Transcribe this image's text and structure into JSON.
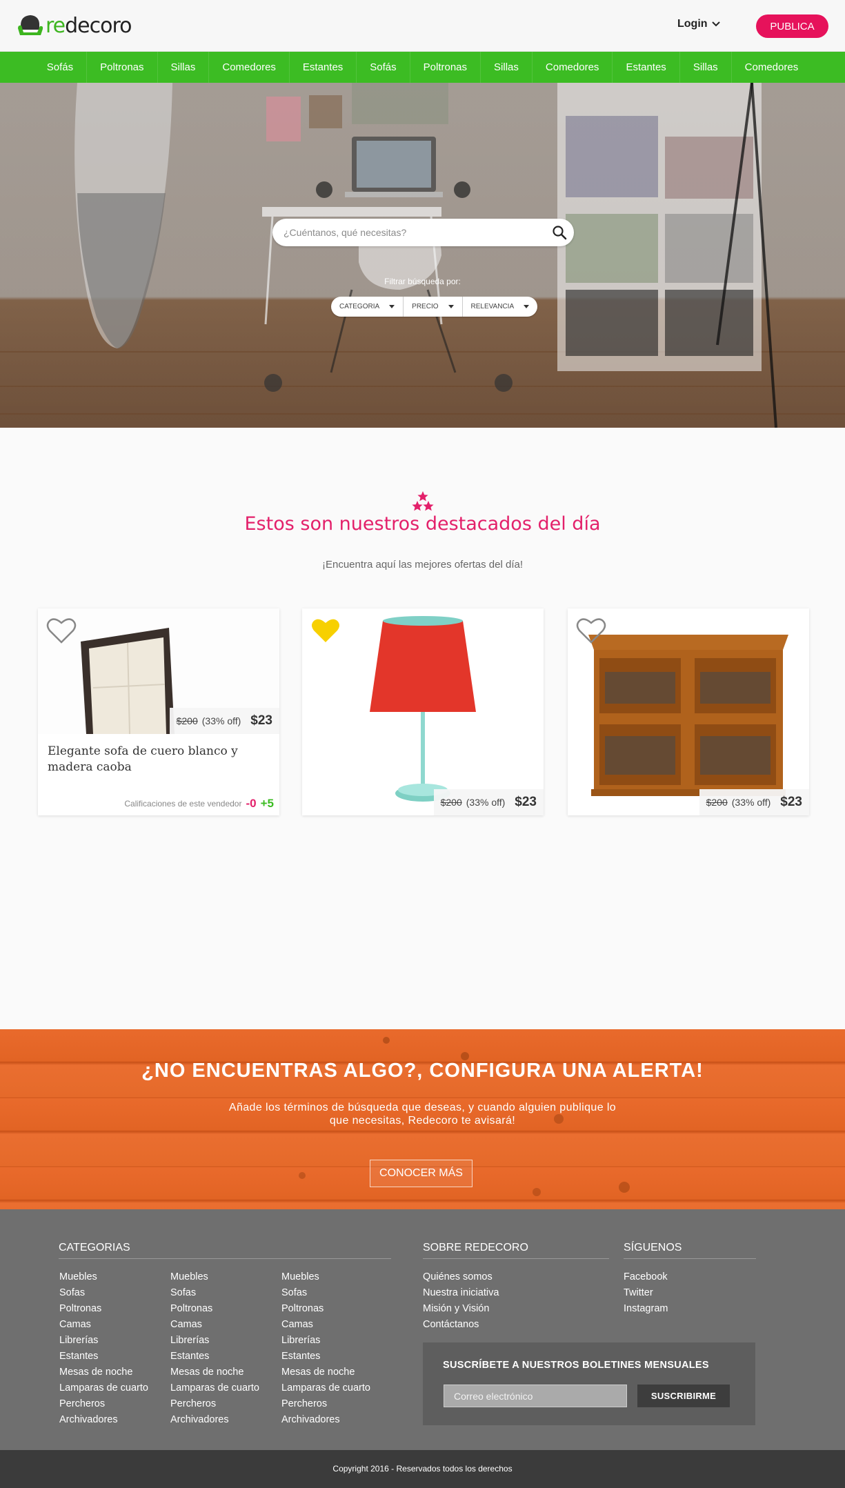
{
  "header": {
    "logo_prefix": "re",
    "logo_rest": "decoro",
    "login_label": "Login",
    "publish_label": "PUBLICA"
  },
  "nav": {
    "items": [
      "Sofás",
      "Poltronas",
      "Sillas",
      "Comedores",
      "Estantes",
      "Sofás",
      "Poltronas",
      "Sillas",
      "Comedores",
      "Estantes",
      "Sillas",
      "Comedores"
    ]
  },
  "hero": {
    "search_placeholder": "¿Cuéntanos, qué necesitas?",
    "filter_label": "Filtrar búsqueda por:",
    "filters": [
      "CATEGORIA",
      "PRECIO",
      "RELEVANCIA"
    ]
  },
  "featured": {
    "title": "Estos son nuestros destacados del día",
    "subtitle": "¡Encuentra aquí las mejores ofertas del día!",
    "cards": [
      {
        "favorited": false,
        "old_price": "$200",
        "discount": "(33% off)",
        "price": "$23",
        "title": "Elegante sofa de cuero blanco y madera caoba",
        "rating_label": "Calificaciones de este vendedor",
        "rating_negative": "-0",
        "rating_positive": "+5",
        "image_icon": "leather-chair-image"
      },
      {
        "favorited": true,
        "old_price": "$200",
        "discount": "(33% off)",
        "price": "$23",
        "image_icon": "red-lamp-image"
      },
      {
        "favorited": false,
        "old_price": "$200",
        "discount": "(33% off)",
        "price": "$23",
        "image_icon": "wooden-cabinet-image"
      }
    ]
  },
  "alert": {
    "title": "¿NO ENCUENTRAS ALGO?, CONFIGURA UNA ALERTA!",
    "subtitle": "Añade los términos de búsqueda que deseas, y cuando alguien publique lo que necesitas, Redecoro te avisará!",
    "button_label": "CONOCER MÁS"
  },
  "footer": {
    "categories_title": "CATEGORIAS",
    "categories_columns": [
      [
        "Muebles",
        "Sofas",
        "Poltronas",
        "Camas",
        "Librerías",
        "Estantes",
        "Mesas de noche",
        "Lamparas de cuarto",
        "Percheros",
        "Archivadores"
      ],
      [
        "Muebles",
        "Sofas",
        "Poltronas",
        "Camas",
        "Librerías",
        "Estantes",
        "Mesas de noche",
        "Lamparas de cuarto",
        "Percheros",
        "Archivadores"
      ],
      [
        "Muebles",
        "Sofas",
        "Poltronas",
        "Camas",
        "Librerías",
        "Estantes",
        "Mesas de noche",
        "Lamparas de cuarto",
        "Percheros",
        "Archivadores"
      ]
    ],
    "about_title": "SOBRE REDECORO",
    "about_links": [
      "Quiénes somos",
      "Nuestra iniciativa",
      "Misión y Visión",
      "Contáctanos"
    ],
    "follow_title": "SÍGUENOS",
    "follow_links": [
      "Facebook",
      "Twitter",
      "Instagram"
    ],
    "newsletter_title": "SUSCRÍBETE A NUESTROS BOLETINES MENSUALES",
    "newsletter_placeholder": "Correo electrónico",
    "newsletter_button": "SUSCRIBIRME",
    "copyright": "Copyright 2016 - Reservados todos los derechos"
  },
  "colors": {
    "brand_green": "#3cbc23",
    "brand_pink": "#e6125b",
    "alert_orange": "#e5672a",
    "footer_gray": "#6f6f6f",
    "favorite_yellow": "#f7d000"
  }
}
